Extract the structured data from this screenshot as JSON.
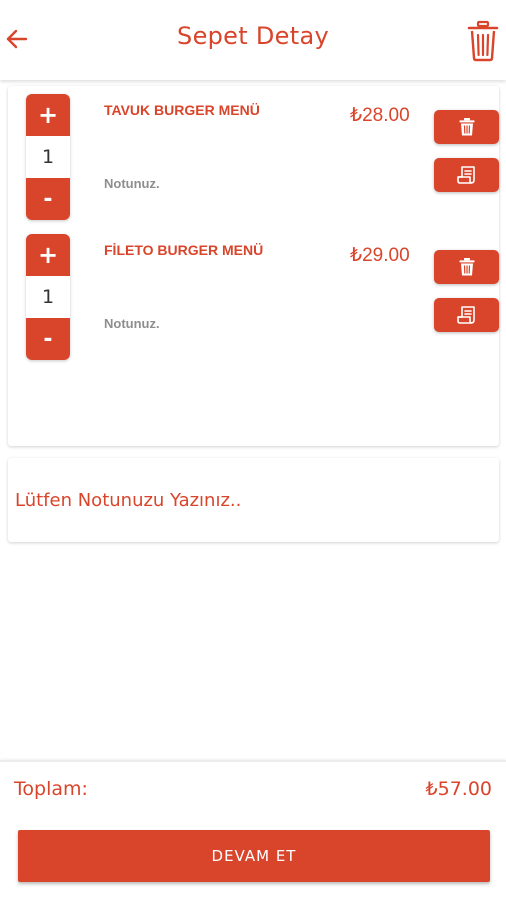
{
  "header": {
    "title": "Sepet Detay",
    "back_icon": "arrow-left-icon",
    "clear_icon": "trash-icon"
  },
  "cart": {
    "items": [
      {
        "name": "TAVUK BURGER MENÜ",
        "price": "₺28.00",
        "quantity": "1",
        "note": "Notunuz.",
        "plus": "+",
        "minus": "-"
      },
      {
        "name": "FİLETO BURGER MENÜ",
        "price": "₺29.00",
        "quantity": "1",
        "note": "Notunuz.",
        "plus": "+",
        "minus": "-"
      }
    ]
  },
  "order_note": {
    "placeholder": "Lütfen Notunuzu Yazınız.."
  },
  "summary": {
    "total_label": "Toplam:",
    "total_value": "₺57.00"
  },
  "actions": {
    "continue_label": "DEVAM ET"
  },
  "colors": {
    "accent": "#d9452b",
    "note_text": "#8e8e8e"
  }
}
